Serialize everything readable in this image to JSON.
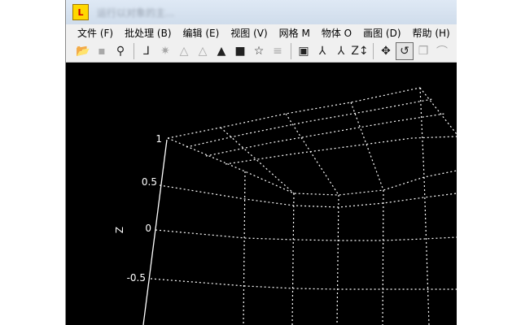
{
  "window": {
    "title": "运行以对象的主..."
  },
  "menu": [
    {
      "label": "文件 (F)"
    },
    {
      "label": "批处理 (B)"
    },
    {
      "label": "编辑 (E)"
    },
    {
      "label": "视图 (V)"
    },
    {
      "label": "网格 M"
    },
    {
      "label": "物体 O"
    },
    {
      "label": "画图 (D)"
    },
    {
      "label": "帮助 (H)"
    }
  ],
  "toolbar": [
    {
      "icon": "open-folder-icon",
      "glyph": "📂",
      "enabled": true
    },
    {
      "icon": "save-icon",
      "glyph": "▪",
      "enabled": false
    },
    {
      "icon": "antenna-icon",
      "glyph": "⚲",
      "enabled": true
    },
    {
      "separator": true
    },
    {
      "icon": "axis-icon",
      "glyph": "⅃",
      "enabled": true
    },
    {
      "icon": "light-icon",
      "glyph": "✷",
      "enabled": false
    },
    {
      "icon": "mesh-cone-icon",
      "glyph": "△",
      "enabled": false
    },
    {
      "icon": "wire-cone-icon",
      "glyph": "△",
      "enabled": false
    },
    {
      "icon": "solid-cone-icon",
      "glyph": "▲",
      "enabled": true
    },
    {
      "icon": "color-cube-icon",
      "glyph": "■",
      "enabled": true
    },
    {
      "icon": "star-icon",
      "glyph": "☆",
      "enabled": true
    },
    {
      "icon": "lines-icon",
      "glyph": "≡",
      "enabled": false
    },
    {
      "separator": true
    },
    {
      "icon": "bounding-box-icon",
      "glyph": "▣",
      "enabled": true
    },
    {
      "icon": "axes-xyz-icon",
      "glyph": "⅄",
      "enabled": true
    },
    {
      "icon": "axes-xy-icon",
      "glyph": "⅄",
      "enabled": true
    },
    {
      "icon": "z-scale-icon",
      "glyph": "Z↕",
      "enabled": true
    },
    {
      "separator": true
    },
    {
      "icon": "move-icon",
      "glyph": "✥",
      "enabled": true
    },
    {
      "icon": "rotate-icon",
      "glyph": "↺",
      "enabled": true,
      "active": true
    },
    {
      "icon": "cube-rotate-icon",
      "glyph": "❒",
      "enabled": false
    },
    {
      "icon": "arc-icon",
      "glyph": "⌒",
      "enabled": false
    }
  ],
  "plot": {
    "background": "#000000",
    "grid_color": "#ffffff",
    "z_axis_label": "Z",
    "z_ticks": [
      "1",
      "0.5",
      "0",
      "-0.5"
    ]
  }
}
